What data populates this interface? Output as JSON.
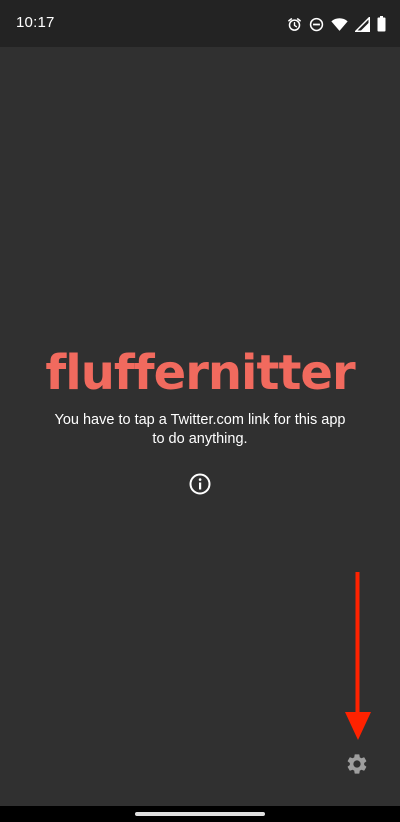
{
  "status_bar": {
    "time": "10:17",
    "icons": [
      "alarm-icon",
      "do-not-disturb-icon",
      "wifi-icon",
      "cell-signal-icon",
      "battery-icon"
    ]
  },
  "main": {
    "app_title": "fluffernitter",
    "hint": "You have to tap a Twitter.com link for this app to do anything.",
    "info_icon": "info-icon",
    "settings_icon": "gear-icon"
  },
  "annotation": {
    "arrow_color": "#ff2200"
  },
  "colors": {
    "background": "#303030",
    "status_bar": "#232323",
    "accent": "#f16a5e",
    "settings_icon": "#9e9e9e"
  }
}
